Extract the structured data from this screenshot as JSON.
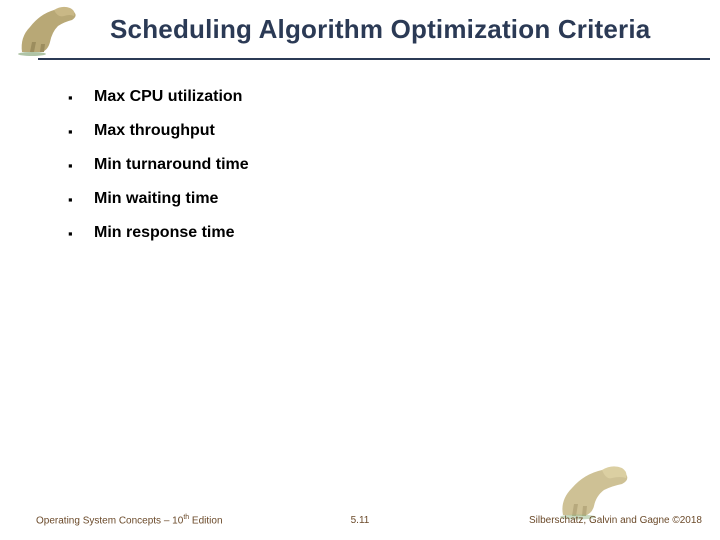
{
  "header": {
    "title": "Scheduling Algorithm Optimization Criteria"
  },
  "bullets": [
    {
      "text": "Max CPU utilization"
    },
    {
      "text": "Max throughput"
    },
    {
      "text": "Min turnaround time"
    },
    {
      "text": "Min waiting time"
    },
    {
      "text": "Min response time"
    }
  ],
  "footer": {
    "left_prefix": "Operating System Concepts – 10",
    "left_sup": "th",
    "left_suffix": " Edition",
    "center": "5.11",
    "right": "Silberschatz, Galvin and Gagne ©2018"
  }
}
